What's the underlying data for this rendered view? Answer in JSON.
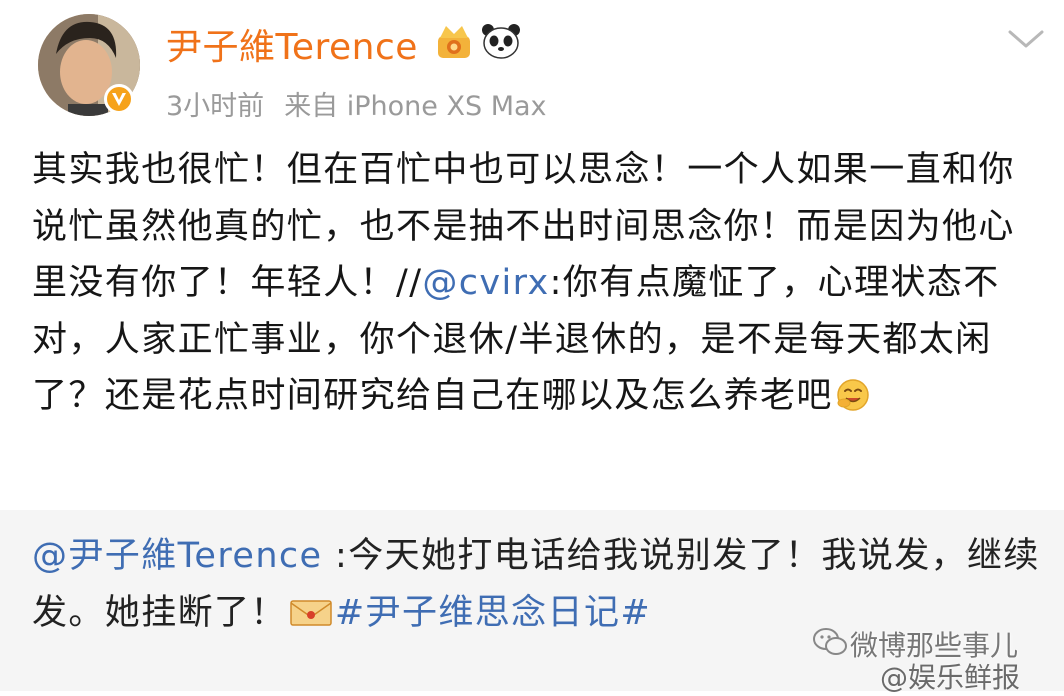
{
  "post": {
    "username": "尹子維Terence",
    "time": "3小时前",
    "source": "来自 iPhone XS Max",
    "text_before_mention": "其实我也很忙！但在百忙中也可以思念！一个人如果一直和你说忙虽然他真的忙，也不是抽不出时间思念你！而是因为他心里没有你了！年轻人！//",
    "mention": "@cvirx",
    "text_after_mention": ":你有点魔怔了，心理状态不对，人家正忙事业，你个退休/半退休的，是不是每天都太闲了？还是花点时间研究给自己在哪以及怎么养老吧",
    "emoji": "smile-icon"
  },
  "repost": {
    "user": "@尹子維Terence",
    "text": " :今天她打电话给我说别发了！我说发，继续发。她挂断了！",
    "topic": "#尹子维思念日记#"
  },
  "watermark": {
    "line1": "微博那些事儿",
    "line2": "@娱乐鲜报"
  },
  "colors": {
    "username": "#f07219",
    "link": "#3f6db3",
    "meta": "#9a9a9a",
    "repost_bg": "#f5f5f5"
  }
}
